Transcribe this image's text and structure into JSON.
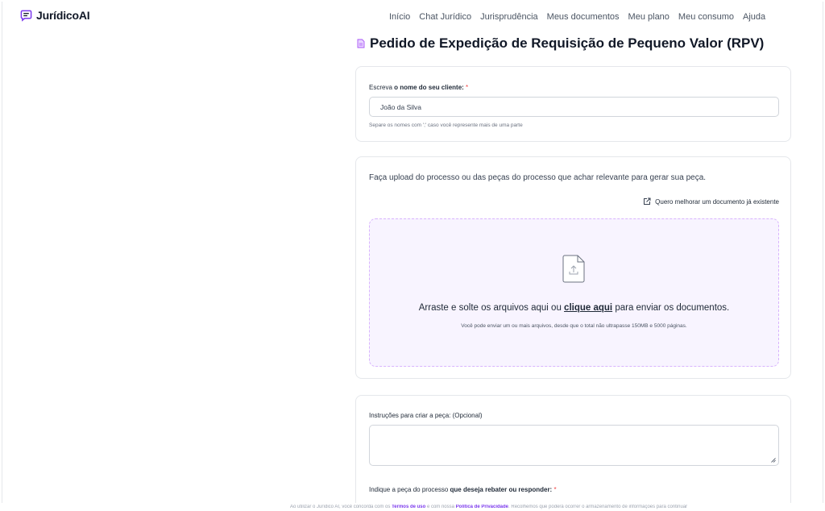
{
  "app": {
    "logo_text": "JurídicoAI"
  },
  "nav": {
    "items": [
      "Início",
      "Chat Jurídico",
      "Jurisprudência",
      "Meus documentos",
      "Meu plano",
      "Meu consumo",
      "Ajuda"
    ]
  },
  "page": {
    "title": "Pedido de Expedição de Requisição de Pequeno Valor (RPV)"
  },
  "client_card": {
    "label_prefix": "Escreva ",
    "label_bold": "o nome do seu cliente:",
    "required_mark": " *",
    "value": "João da Silva",
    "hint": "Separe os nomes com ';' caso você represente mais de uma parte"
  },
  "upload_card": {
    "lead": "Faça upload do processo ou das peças do processo que achar relevante para gerar sua peça.",
    "improve_link": "Quero melhorar um documento já existente",
    "drop_before": "Arraste e solte os arquivos aqui ou ",
    "drop_link": "clique aqui",
    "drop_after": " para enviar os documentos.",
    "drop_sub": "Você pode enviar um ou mais arquivos, desde que o total não ultrapasse 150MB e 5000 páginas."
  },
  "instructions_card": {
    "label": "Instruções para criar a peça: (Opcional)",
    "rebut_label_prefix": "Indique a peça do processo ",
    "rebut_label_bold": "que deseja rebater ou responder:",
    "required_mark": " *"
  },
  "footer": {
    "before": "Ao utilizar o Jurídico AI, você concorda com os ",
    "terms": "Termos de uso",
    "middle": " e com nossa ",
    "privacy": "Política de Privacidade",
    "after": ". Recolhemos que poderá ocorrer o armazenamento de informações para continuar"
  },
  "colors": {
    "accent": "#7c3aed",
    "dropzone_bg": "#f8f4ff",
    "dropzone_border": "#d8b4fe",
    "required": "#ef4444"
  }
}
